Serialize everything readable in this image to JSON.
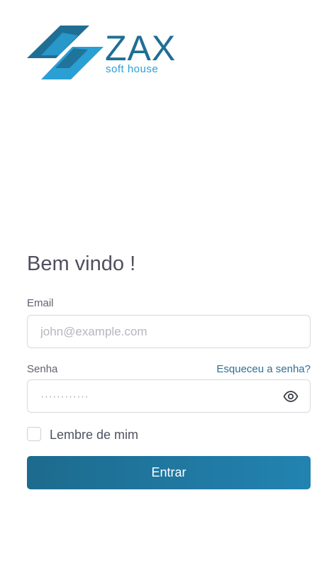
{
  "brand": {
    "name": "ZAX",
    "tagline": "soft house",
    "colors": {
      "dark": "#1f6e94",
      "light": "#2a9fd4"
    }
  },
  "login": {
    "heading": "Bem vindo !",
    "email": {
      "label": "Email",
      "placeholder": "john@example.com",
      "value": ""
    },
    "password": {
      "label": "Senha",
      "forgot_link": "Esqueceu a senha?",
      "placeholder": "············",
      "value": "",
      "toggle_icon": "eye-icon"
    },
    "remember": {
      "label": "Lembre de mim",
      "checked": false
    },
    "submit_label": "Entrar"
  },
  "colors": {
    "primary": "#1d6b8e",
    "primary_light": "#2283b1",
    "text": "#4f4f5e",
    "link": "#2f6f95"
  }
}
